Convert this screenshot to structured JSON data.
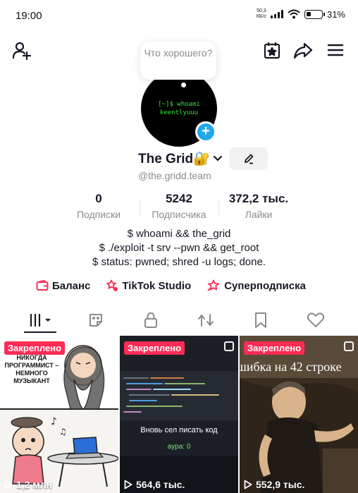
{
  "status_bar": {
    "time": "19:00",
    "net_speed_value": "50,3",
    "net_speed_unit": "КБ/с",
    "battery": "31%",
    "battery_level": 0.31
  },
  "top_bar": {
    "icons": [
      "add-friend-icon",
      "calendar-star-icon",
      "share-icon",
      "menu-icon"
    ]
  },
  "profile": {
    "bubble_text": "Что хорошего?",
    "avatar_lines": [
      "[~]$ whoami",
      "keentlyuuu"
    ],
    "name": "The Grid🔐",
    "handle": "@the.gridd.team",
    "stats": [
      {
        "value": "0",
        "label": "Подписки"
      },
      {
        "value": "5242",
        "label": "Подписчика"
      },
      {
        "value": "372,2 тыс.",
        "label": "Лайки"
      }
    ],
    "bio": [
      "$ whoami && the_grid",
      "$ ./exploit -t srv --pwn && get_root",
      "$ status: pwned; shred -u logs; done."
    ]
  },
  "links": [
    {
      "label": "Баланс",
      "icon": "wallet-icon"
    },
    {
      "label": "TikTok Studio",
      "icon": "studio-icon"
    },
    {
      "label": "Суперподписка",
      "icon": "super-subscription-icon"
    }
  ],
  "tabs": [
    {
      "icon": "videos-grid-icon",
      "active": true
    },
    {
      "icon": "sticker-icon"
    },
    {
      "icon": "lock-icon"
    },
    {
      "icon": "repost-icon"
    },
    {
      "icon": "bookmark-icon"
    },
    {
      "icon": "heart-icon"
    }
  ],
  "videos": [
    {
      "pinned_label": "Закреплено",
      "views": "1,2 млн",
      "caption_lines": [
        "НИКОГДА",
        "ПРОГРАММИСТ –",
        "НЕМНОГО",
        "МУЗЫКАНТ"
      ]
    },
    {
      "pinned_label": "Закреплено",
      "views": "564,6 тыс.",
      "caption": "Вновь сел писать код",
      "sub_caption": "aypa: 0"
    },
    {
      "pinned_label": "Закреплено",
      "views": "552,9 тыс.",
      "caption": "шибка на 42 строке"
    }
  ],
  "colors": {
    "accent": "#fe2c55",
    "badge_blue": "#20a8e8",
    "terminal_green": "#35e03a"
  }
}
